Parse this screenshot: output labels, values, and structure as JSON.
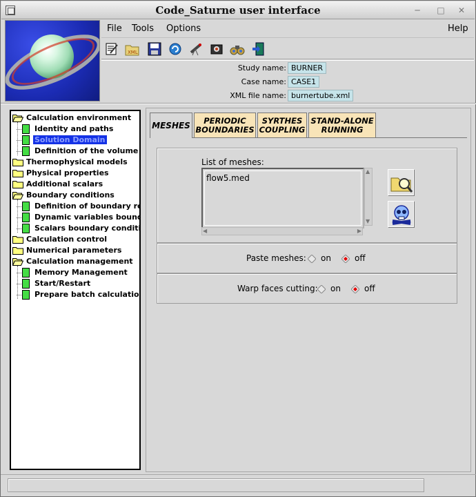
{
  "window": {
    "title": "Code_Saturne user interface"
  },
  "menu": {
    "file": "File",
    "tools": "Tools",
    "options": "Options",
    "help": "Help"
  },
  "toolbar": {
    "icons": [
      "edit-icon",
      "open-xml-icon",
      "save-icon",
      "rotate-icon",
      "telescope-icon",
      "camera-icon",
      "binoculars-icon",
      "exit-icon"
    ]
  },
  "info": {
    "study_label": "Study name:",
    "study_value": "BURNER",
    "case_label": "Case name:",
    "case_value": "CASE1",
    "xml_label": "XML file name:",
    "xml_value": "burnertube.xml"
  },
  "tree": {
    "items": [
      {
        "label": "Calculation environment",
        "type": "folder-open",
        "level": 0
      },
      {
        "label": "Identity and paths",
        "type": "page",
        "level": 1
      },
      {
        "label": "Solution Domain",
        "type": "page",
        "level": 1,
        "selected": true
      },
      {
        "label": "Definition of the volume zones",
        "type": "page",
        "level": 1
      },
      {
        "label": "Thermophysical models",
        "type": "folder",
        "level": 0
      },
      {
        "label": "Physical properties",
        "type": "folder",
        "level": 0
      },
      {
        "label": "Additional scalars",
        "type": "folder",
        "level": 0
      },
      {
        "label": "Boundary conditions",
        "type": "folder-open",
        "level": 0
      },
      {
        "label": "Definition of boundary regions",
        "type": "page",
        "level": 1
      },
      {
        "label": "Dynamic variables bound. cond.",
        "type": "page",
        "level": 1
      },
      {
        "label": "Scalars boundary conditions",
        "type": "page",
        "level": 1
      },
      {
        "label": "Calculation control",
        "type": "folder",
        "level": 0
      },
      {
        "label": "Numerical parameters",
        "type": "folder",
        "level": 0
      },
      {
        "label": "Calculation management",
        "type": "folder-open",
        "level": 0
      },
      {
        "label": "Memory Management",
        "type": "page",
        "level": 1
      },
      {
        "label": "Start/Restart",
        "type": "page",
        "level": 1
      },
      {
        "label": "Prepare batch calculation",
        "type": "page",
        "level": 1
      }
    ]
  },
  "tabs": {
    "meshes": "MESHES",
    "periodic_1": "PERIODIC",
    "periodic_2": "BOUNDARIES",
    "syrthes_1": "SYRTHES",
    "syrthes_2": "COUPLING",
    "standalone_1": "STAND-ALONE",
    "standalone_2": "RUNNING"
  },
  "meshes": {
    "list_label": "List of meshes:",
    "items": [
      "flow5.med"
    ]
  },
  "options": {
    "paste_label": "Paste meshes:",
    "paste_on": "on",
    "paste_off": "off",
    "paste_selected": "off",
    "warp_label": "Warp faces cutting:",
    "warp_on": "on",
    "warp_off": "off",
    "warp_selected": "off"
  },
  "status": {
    "text": ""
  }
}
